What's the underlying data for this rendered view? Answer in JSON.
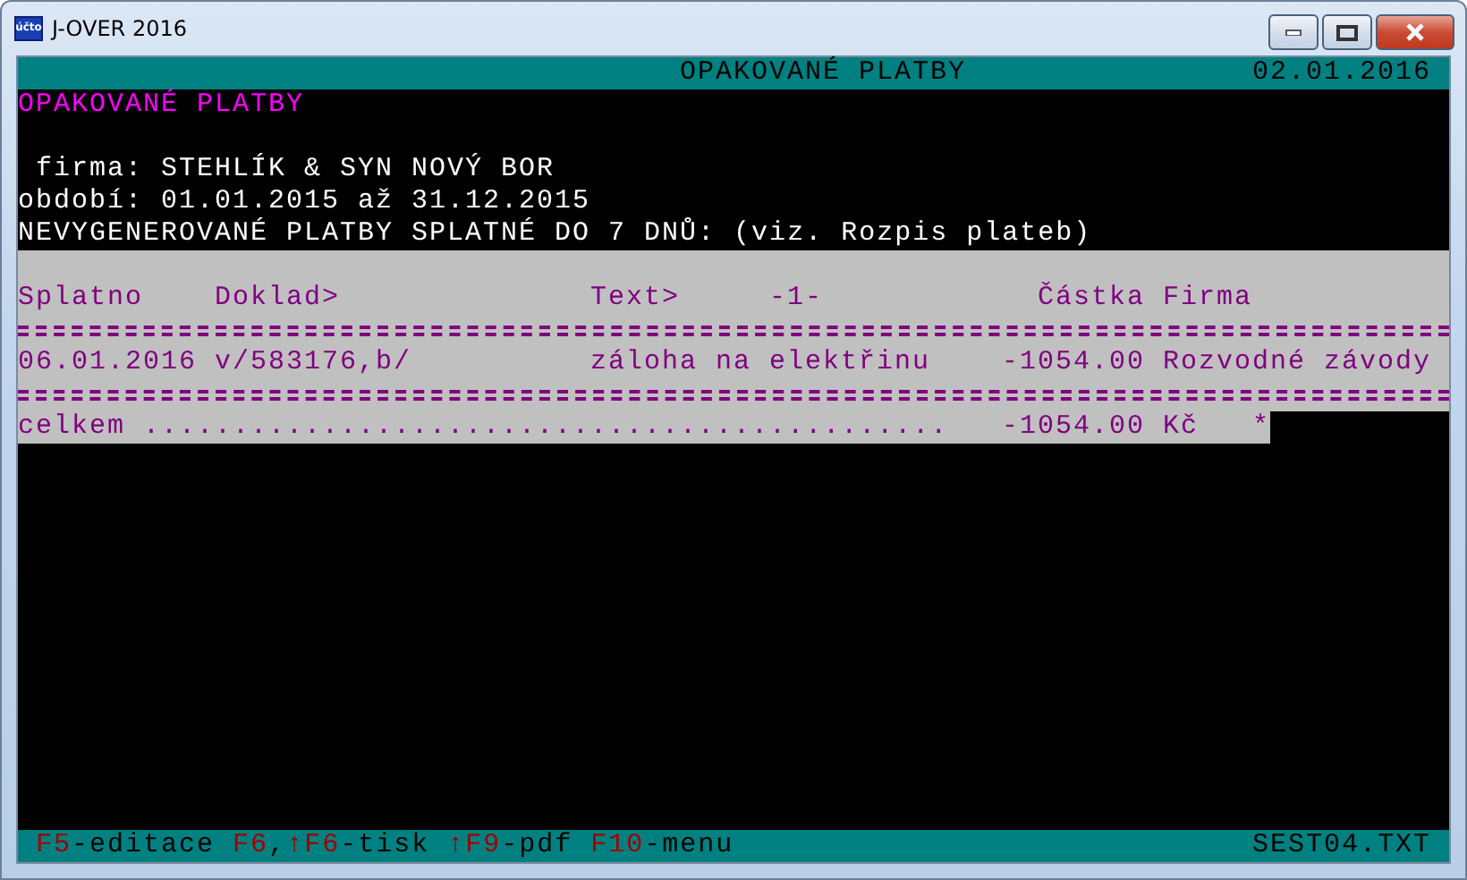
{
  "window": {
    "icon_text": "účto",
    "title": "J-OVER 2016"
  },
  "header": {
    "title": "OPAKOVANÉ PLATBY",
    "date": "02.01.2016"
  },
  "heading": "OPAKOVANÉ PLATBY",
  "info_lines": [
    " firma: STEHLÍK & SYN NOVÝ BOR",
    "období: 01.01.2015 až 31.12.2015",
    "NEVYGENEROVANÉ PLATBY SPLATNÉ DO 7 DNŮ: (viz. Rozpis plateb)"
  ],
  "table": {
    "columns": [
      "Splatno",
      "Doklad>",
      "Text>",
      "-1-",
      "Částka",
      "Firma"
    ],
    "rows": [
      {
        "cells": [
          "06.01.2016",
          "v/583176,b/",
          "záloha na elektřinu",
          "",
          "-1054.00",
          "Rozvodné závody"
        ]
      }
    ],
    "total": {
      "label": "celkem .............................................",
      "amount": "-1054.00",
      "currency": "Kč",
      "mark": "*"
    }
  },
  "footer": {
    "segments": [
      {
        "text": "F5",
        "kind": "key"
      },
      {
        "text": "-editace ",
        "kind": "plain"
      },
      {
        "text": "F6",
        "kind": "key"
      },
      {
        "text": ",",
        "kind": "plain"
      },
      {
        "text": "↑F6",
        "kind": "key"
      },
      {
        "text": "-tisk ",
        "kind": "plain"
      },
      {
        "text": "↑F9",
        "kind": "key"
      },
      {
        "text": "-pdf ",
        "kind": "plain"
      },
      {
        "text": "F10",
        "kind": "key"
      },
      {
        "text": "-menu",
        "kind": "plain"
      }
    ],
    "file": "SEST04.TXT"
  }
}
